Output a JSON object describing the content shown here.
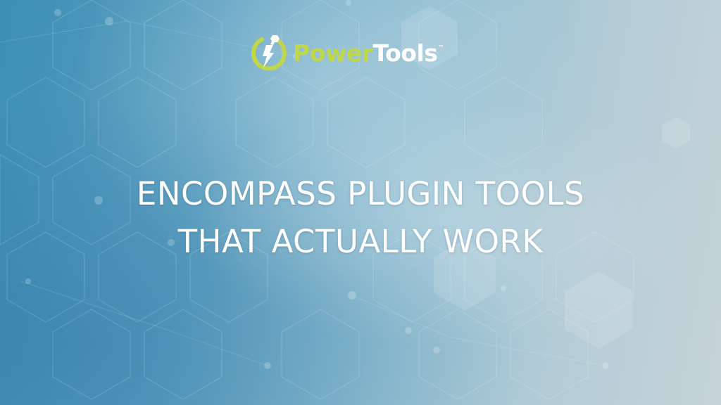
{
  "colors": {
    "brand_green": "#c1d74a",
    "brand_white": "#ffffff",
    "background_start": "#3d8eb5",
    "background_end": "#c6d3d9"
  },
  "logo": {
    "icon": "lightning-wrench-icon",
    "word_part_1": "Power",
    "word_part_2": "Tools",
    "trademark": "™"
  },
  "headline": {
    "line_1": "ENCOMPASS PLUGIN TOOLS",
    "line_2": "THAT ACTUALLY WORK"
  }
}
